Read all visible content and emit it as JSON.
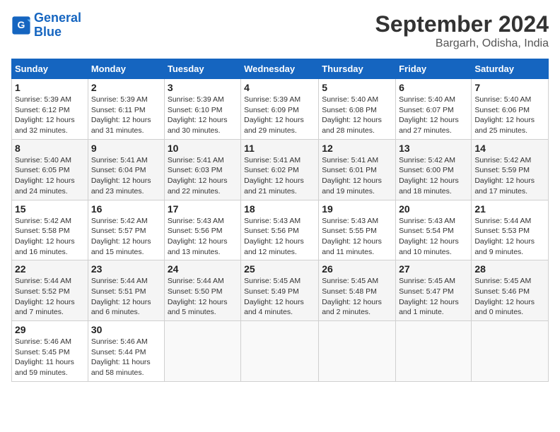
{
  "logo": {
    "line1": "General",
    "line2": "Blue"
  },
  "title": "September 2024",
  "location": "Bargarh, Odisha, India",
  "days_of_week": [
    "Sunday",
    "Monday",
    "Tuesday",
    "Wednesday",
    "Thursday",
    "Friday",
    "Saturday"
  ],
  "weeks": [
    [
      {
        "num": "1",
        "info": "Sunrise: 5:39 AM\nSunset: 6:12 PM\nDaylight: 12 hours\nand 32 minutes."
      },
      {
        "num": "2",
        "info": "Sunrise: 5:39 AM\nSunset: 6:11 PM\nDaylight: 12 hours\nand 31 minutes."
      },
      {
        "num": "3",
        "info": "Sunrise: 5:39 AM\nSunset: 6:10 PM\nDaylight: 12 hours\nand 30 minutes."
      },
      {
        "num": "4",
        "info": "Sunrise: 5:39 AM\nSunset: 6:09 PM\nDaylight: 12 hours\nand 29 minutes."
      },
      {
        "num": "5",
        "info": "Sunrise: 5:40 AM\nSunset: 6:08 PM\nDaylight: 12 hours\nand 28 minutes."
      },
      {
        "num": "6",
        "info": "Sunrise: 5:40 AM\nSunset: 6:07 PM\nDaylight: 12 hours\nand 27 minutes."
      },
      {
        "num": "7",
        "info": "Sunrise: 5:40 AM\nSunset: 6:06 PM\nDaylight: 12 hours\nand 25 minutes."
      }
    ],
    [
      {
        "num": "8",
        "info": "Sunrise: 5:40 AM\nSunset: 6:05 PM\nDaylight: 12 hours\nand 24 minutes."
      },
      {
        "num": "9",
        "info": "Sunrise: 5:41 AM\nSunset: 6:04 PM\nDaylight: 12 hours\nand 23 minutes."
      },
      {
        "num": "10",
        "info": "Sunrise: 5:41 AM\nSunset: 6:03 PM\nDaylight: 12 hours\nand 22 minutes."
      },
      {
        "num": "11",
        "info": "Sunrise: 5:41 AM\nSunset: 6:02 PM\nDaylight: 12 hours\nand 21 minutes."
      },
      {
        "num": "12",
        "info": "Sunrise: 5:41 AM\nSunset: 6:01 PM\nDaylight: 12 hours\nand 19 minutes."
      },
      {
        "num": "13",
        "info": "Sunrise: 5:42 AM\nSunset: 6:00 PM\nDaylight: 12 hours\nand 18 minutes."
      },
      {
        "num": "14",
        "info": "Sunrise: 5:42 AM\nSunset: 5:59 PM\nDaylight: 12 hours\nand 17 minutes."
      }
    ],
    [
      {
        "num": "15",
        "info": "Sunrise: 5:42 AM\nSunset: 5:58 PM\nDaylight: 12 hours\nand 16 minutes."
      },
      {
        "num": "16",
        "info": "Sunrise: 5:42 AM\nSunset: 5:57 PM\nDaylight: 12 hours\nand 15 minutes."
      },
      {
        "num": "17",
        "info": "Sunrise: 5:43 AM\nSunset: 5:56 PM\nDaylight: 12 hours\nand 13 minutes."
      },
      {
        "num": "18",
        "info": "Sunrise: 5:43 AM\nSunset: 5:56 PM\nDaylight: 12 hours\nand 12 minutes."
      },
      {
        "num": "19",
        "info": "Sunrise: 5:43 AM\nSunset: 5:55 PM\nDaylight: 12 hours\nand 11 minutes."
      },
      {
        "num": "20",
        "info": "Sunrise: 5:43 AM\nSunset: 5:54 PM\nDaylight: 12 hours\nand 10 minutes."
      },
      {
        "num": "21",
        "info": "Sunrise: 5:44 AM\nSunset: 5:53 PM\nDaylight: 12 hours\nand 9 minutes."
      }
    ],
    [
      {
        "num": "22",
        "info": "Sunrise: 5:44 AM\nSunset: 5:52 PM\nDaylight: 12 hours\nand 7 minutes."
      },
      {
        "num": "23",
        "info": "Sunrise: 5:44 AM\nSunset: 5:51 PM\nDaylight: 12 hours\nand 6 minutes."
      },
      {
        "num": "24",
        "info": "Sunrise: 5:44 AM\nSunset: 5:50 PM\nDaylight: 12 hours\nand 5 minutes."
      },
      {
        "num": "25",
        "info": "Sunrise: 5:45 AM\nSunset: 5:49 PM\nDaylight: 12 hours\nand 4 minutes."
      },
      {
        "num": "26",
        "info": "Sunrise: 5:45 AM\nSunset: 5:48 PM\nDaylight: 12 hours\nand 2 minutes."
      },
      {
        "num": "27",
        "info": "Sunrise: 5:45 AM\nSunset: 5:47 PM\nDaylight: 12 hours\nand 1 minute."
      },
      {
        "num": "28",
        "info": "Sunrise: 5:45 AM\nSunset: 5:46 PM\nDaylight: 12 hours\nand 0 minutes."
      }
    ],
    [
      {
        "num": "29",
        "info": "Sunrise: 5:46 AM\nSunset: 5:45 PM\nDaylight: 11 hours\nand 59 minutes."
      },
      {
        "num": "30",
        "info": "Sunrise: 5:46 AM\nSunset: 5:44 PM\nDaylight: 11 hours\nand 58 minutes."
      },
      {
        "num": "",
        "info": ""
      },
      {
        "num": "",
        "info": ""
      },
      {
        "num": "",
        "info": ""
      },
      {
        "num": "",
        "info": ""
      },
      {
        "num": "",
        "info": ""
      }
    ]
  ]
}
